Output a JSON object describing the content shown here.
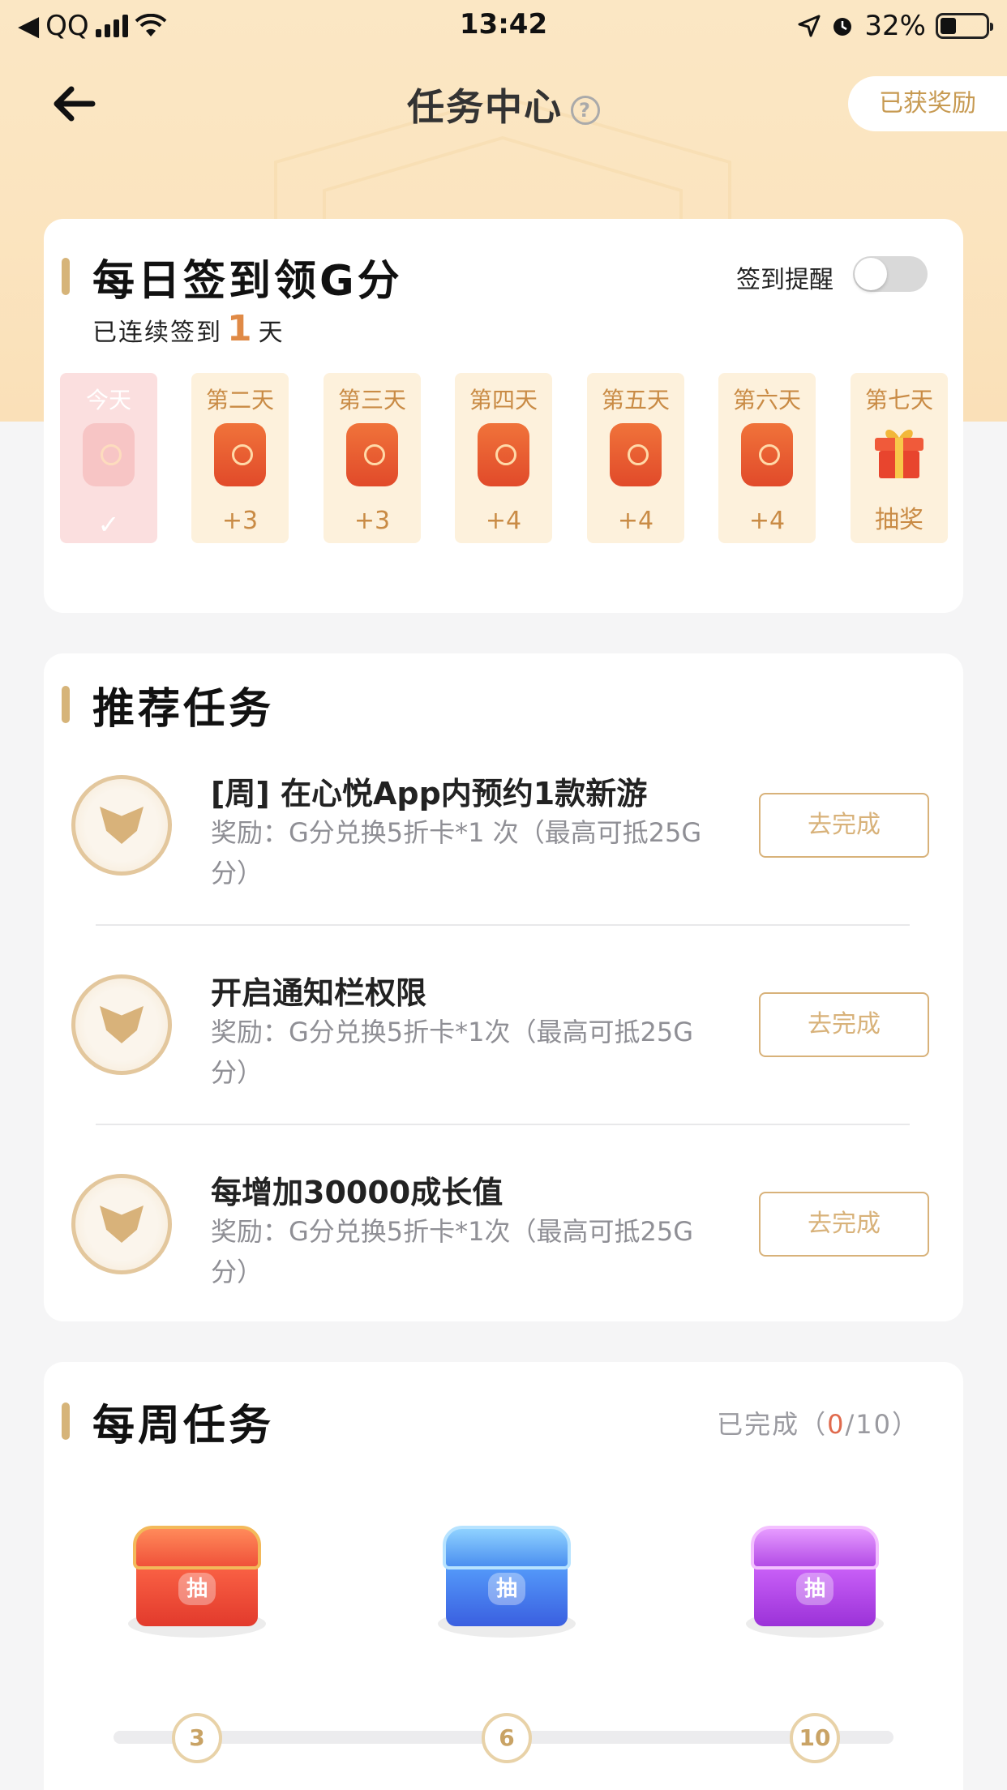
{
  "status_bar": {
    "carrier": "QQ",
    "time": "13:42",
    "battery": "32%",
    "battery_level": 0.32
  },
  "header": {
    "title": "任务中心",
    "help_icon": "?",
    "rewards_button": "已获奖励"
  },
  "checkin": {
    "title": "每日签到领G分",
    "streak_prefix": "已连续签到",
    "streak_days": "1",
    "streak_suffix": "天",
    "reminder_label": "签到提醒",
    "reminder_on": false,
    "days": [
      {
        "label": "今天",
        "reward": "",
        "checked": true
      },
      {
        "label": "第二天",
        "reward": "+3"
      },
      {
        "label": "第三天",
        "reward": "+3"
      },
      {
        "label": "第四天",
        "reward": "+4"
      },
      {
        "label": "第五天",
        "reward": "+4"
      },
      {
        "label": "第六天",
        "reward": "+4"
      },
      {
        "label": "第七天",
        "reward": "抽奖",
        "icon": "gift-icon"
      }
    ]
  },
  "recommended": {
    "title": "推荐任务",
    "tasks": [
      {
        "title": "[周] 在心悦App内预约1款新游",
        "desc": "奖励：G分兑换5折卡*1 次（最高可抵25G分）",
        "button": "去完成"
      },
      {
        "title": "开启通知栏权限",
        "desc": "奖励：G分兑换5折卡*1次（最高可抵25G分）",
        "button": "去完成"
      },
      {
        "title": "每增加30000成长值",
        "desc": "奖励：G分兑换5折卡*1次（最高可抵25G分）",
        "button": "去完成"
      }
    ]
  },
  "weekly": {
    "title": "每周任务",
    "status_prefix": "已完成（",
    "status_done": "0",
    "status_suffix": "/10）",
    "chests": [
      {
        "label": "抽",
        "milestone": "3",
        "color": "#e8473a"
      },
      {
        "label": "抽",
        "milestone": "6",
        "color": "#4b8ff0"
      },
      {
        "label": "抽",
        "milestone": "10",
        "color": "#b34be6"
      }
    ]
  },
  "colors": {
    "accent_gold": "#d8b27a",
    "streak_orange": "#e08a46"
  }
}
